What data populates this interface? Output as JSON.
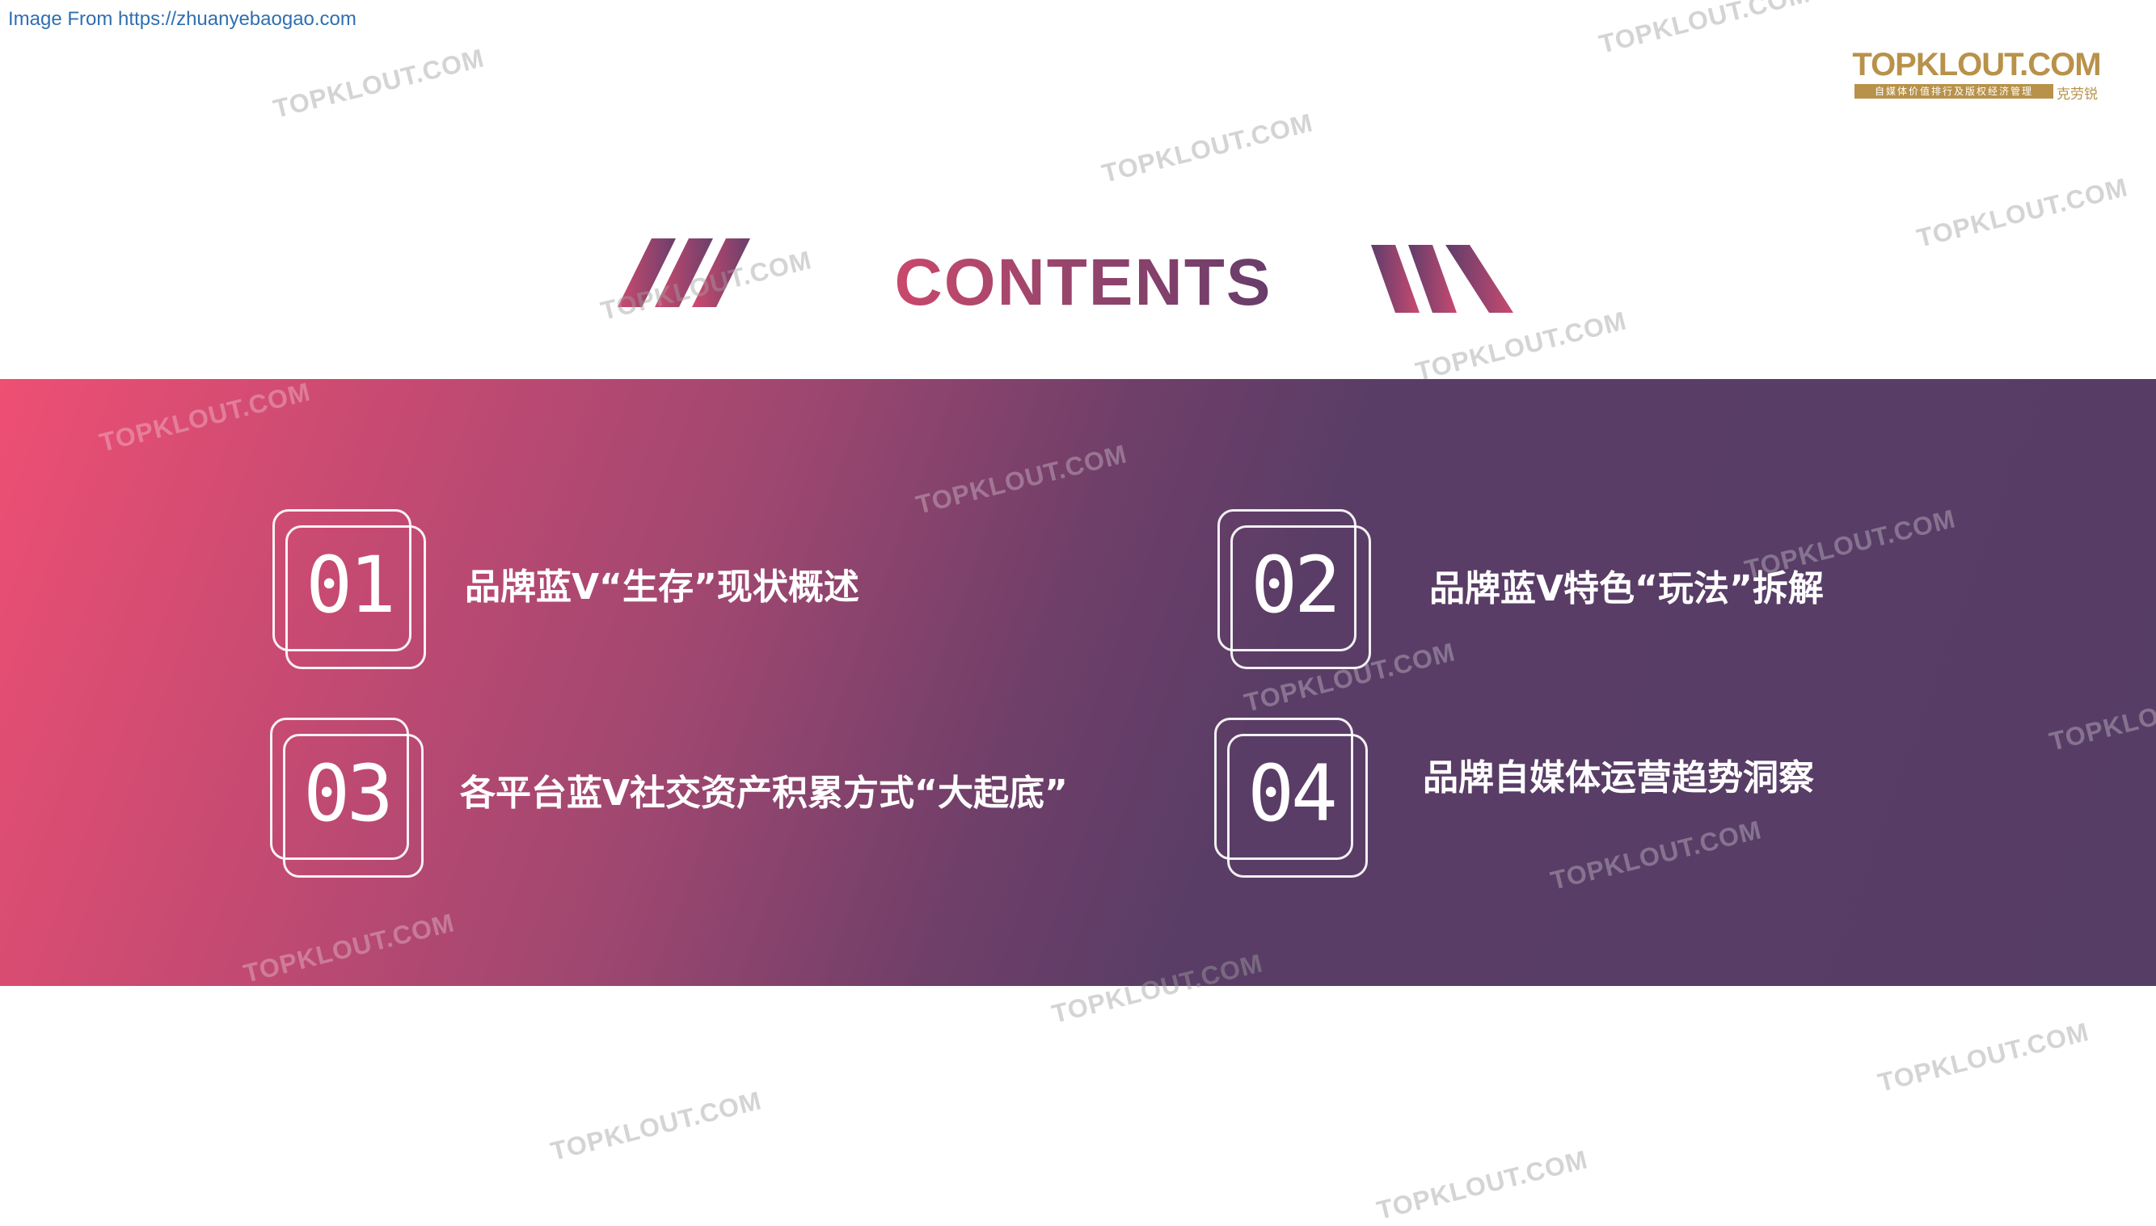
{
  "source_link": "Image From https://zhuanyebaogao.com",
  "logo": {
    "name": "TOPKLOUT.COM",
    "tagline": "自媒体价值排行及版权经济管理",
    "brand_cn": "克劳锐"
  },
  "title": "CONTENTS",
  "colors": {
    "gradient_start": "#ee4f73",
    "gradient_end": "#563d66",
    "logo_gold": "#b8924a"
  },
  "items": [
    {
      "number": "01",
      "label": "品牌蓝V“生存”现状概述"
    },
    {
      "number": "02",
      "label": "品牌蓝V特色“玩法”拆解"
    },
    {
      "number": "03",
      "label": "各平台蓝V社交资产积累方式“大起底”"
    },
    {
      "number": "04",
      "label": "品牌自媒体运营趋势洞察"
    }
  ],
  "watermark": "TOPKLOUT.COM"
}
